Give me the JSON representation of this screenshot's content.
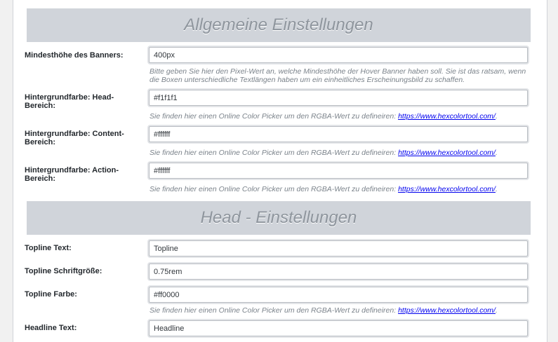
{
  "sections": {
    "general_title": "Allgemeine Einstellungen",
    "head_title": "Head - Einstellungen"
  },
  "general": {
    "banner_height_label": "Mindesthöhe des Banners:",
    "banner_height_value": "400px",
    "banner_height_desc": "Bitte geben Sie hier den Pixel-Wert an, welche Mindesthöhe der Hover Banner haben soll. Sie ist das ratsam, wenn die Boxen unterschiedliche Textlängen haben um ein einheitliches Erscheinungsbild zu schaffen.",
    "bg_head_label": "Hintergrundfarbe: Head-Bereich:",
    "bg_head_value": "#f1f1f1",
    "bg_content_label": "Hintergrundfarbe: Content-Bereich:",
    "bg_content_value": "#ffffff",
    "bg_action_label": "Hintergrundfarbe: Action-Bereich:",
    "bg_action_value": "#ffffff"
  },
  "color_hint": {
    "text": "Sie finden hier einen Online Color Picker um den RGBA-Wert zu defineiren: ",
    "link": "https://www.hexcolortool.com/",
    "suffix": "."
  },
  "head": {
    "topline_text_label": "Topline Text:",
    "topline_text_value": "Topline",
    "topline_size_label": "Topline Schriftgröße:",
    "topline_size_value": "0.75rem",
    "topline_color_label": "Topline Farbe:",
    "topline_color_value": "#ff0000",
    "headline_text_label": "Headline Text:",
    "headline_text_value": "Headline"
  }
}
